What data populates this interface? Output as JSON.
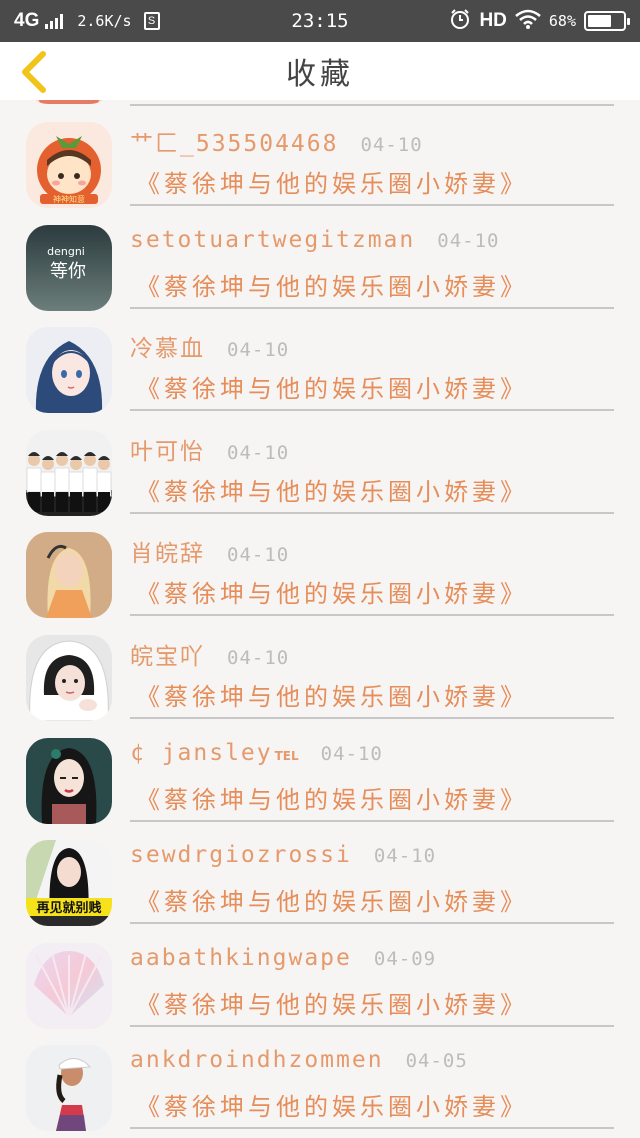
{
  "status_bar": {
    "network": "4G",
    "speed": "2.6K/s",
    "sim_label": "S",
    "time": "23:15",
    "alarm_icon": "alarm-clock-icon",
    "hd": "HD",
    "wifi_icon": "wifi-icon",
    "battery_pct": "68%",
    "battery_level": 0.68
  },
  "nav": {
    "title": "收藏",
    "back_icon": "chevron-left-icon",
    "accent_color": "#f0c419"
  },
  "list": {
    "items": [
      {
        "user": "艹匚_535504468",
        "date": "04-10",
        "book": "《蔡徐坤与他的娱乐圈小娇妻》",
        "avatar": "cartoon-girl-tomato"
      },
      {
        "user": "setotuartwegitzman",
        "date": "04-10",
        "book": "《蔡徐坤与他的娱乐圈小娇妻》",
        "avatar": "text-avatar",
        "avatar_text_top": "dengni",
        "avatar_text_main": "等你"
      },
      {
        "user": "冷慕血",
        "date": "04-10",
        "book": "《蔡徐坤与他的娱乐圈小娇妻》",
        "avatar": "anime-girl-blue-hair"
      },
      {
        "user": "叶可怡",
        "date": "04-10",
        "book": "《蔡徐坤与他的娱乐圈小娇妻》",
        "avatar": "group-photo"
      },
      {
        "user": "肖皖辞",
        "date": "04-10",
        "book": "《蔡徐坤与他的娱乐圈小娇妻》",
        "avatar": "blonde-girl"
      },
      {
        "user": "皖宝吖",
        "date": "04-10",
        "book": "《蔡徐坤与他的娱乐圈小娇妻》",
        "avatar": "girl-white-hood"
      },
      {
        "user": "¢ jansley",
        "user_sup": "TEL",
        "date": "04-10",
        "book": "《蔡徐坤与他的娱乐圈小娇妻》",
        "avatar": "illustrated-girl"
      },
      {
        "user": "sewdrgiozrossi",
        "date": "04-10",
        "book": "《蔡徐坤与他的娱乐圈小娇妻》",
        "avatar": "girl-caption",
        "avatar_caption": "再见就别贱"
      },
      {
        "user": "aabathkingwape",
        "date": "04-09",
        "book": "《蔡徐坤与他的娱乐圈小娇妻》",
        "avatar": "pastel-seashell"
      },
      {
        "user": "ankdroindhzommen",
        "date": "04-05",
        "book": "《蔡徐坤与他的娱乐圈小娇妻》",
        "avatar": "girl-cap"
      }
    ]
  },
  "colors": {
    "status_bg": "#4a4a4a",
    "username": "#e59a6c",
    "book_title": "#e58e5a",
    "date": "#bcbcbc",
    "divider": "#c7c7c7",
    "background": "#f7f4f4"
  }
}
